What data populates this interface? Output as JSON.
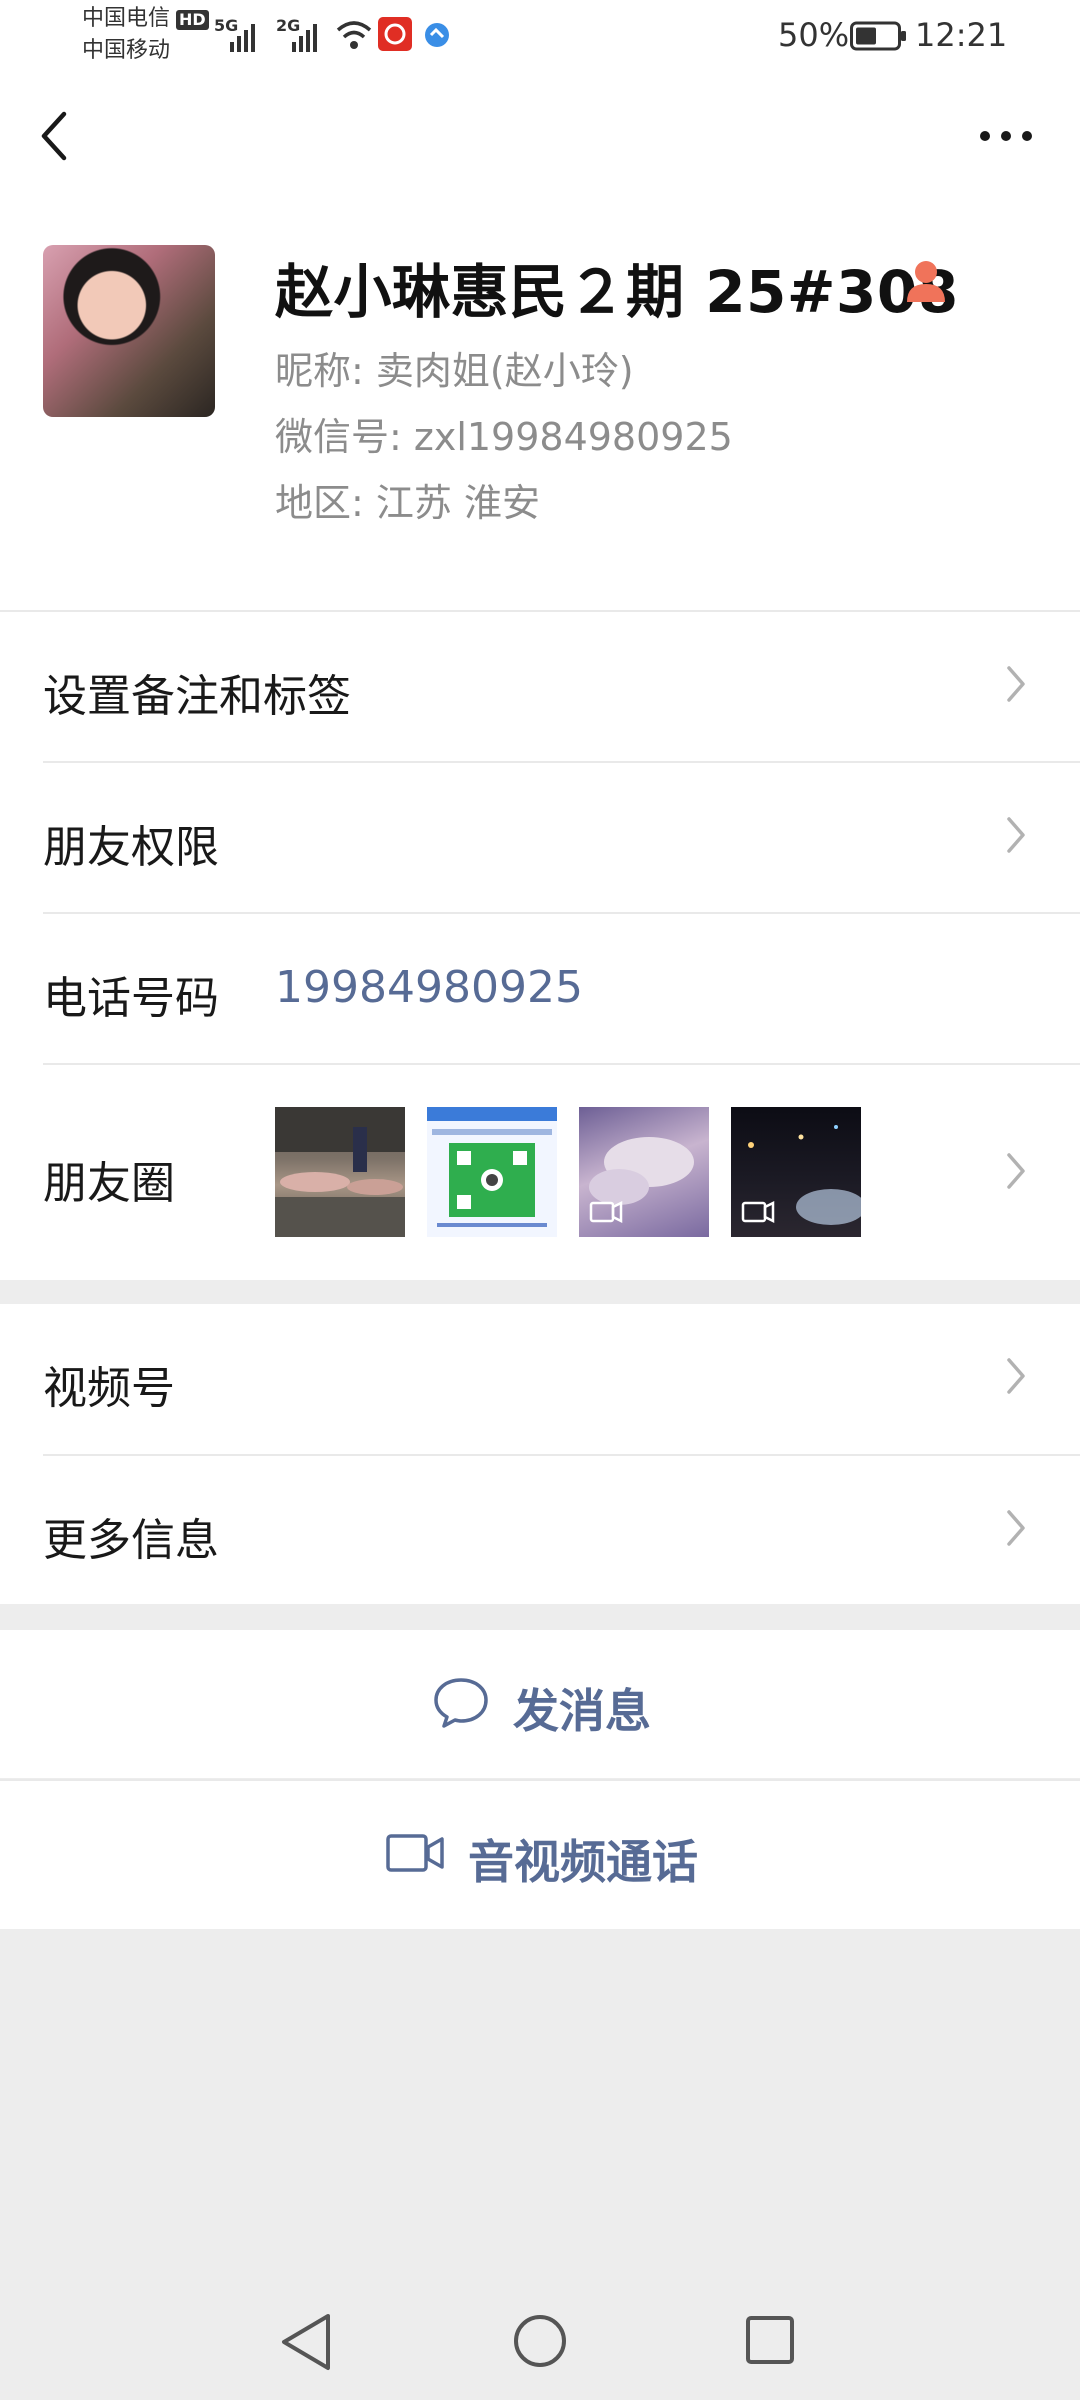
{
  "status_bar": {
    "carrier_1": "中国电信",
    "hd_badge": "HD",
    "carrier_2": "中国移动",
    "net_5g": "5G",
    "net_2g": "2G",
    "battery_percent": "50%",
    "time": "12:21"
  },
  "profile": {
    "name": "赵小琳惠民２期 25#308",
    "nickname_line": "昵称:  卖肉姐(赵小玲)",
    "wechat_id_line": "微信号:  zxl19984980925",
    "region_line": "地区:  江苏  淮安"
  },
  "rows": {
    "remark_tags": "设置备注和标签",
    "friend_permissions": "朋友权限",
    "phone_label": "电话号码",
    "phone_value": "19984980925",
    "moments": "朋友圈",
    "channels": "视频号",
    "more_info": "更多信息"
  },
  "actions": {
    "send_message": "发消息",
    "av_call": "音视频通话"
  },
  "colors": {
    "link_blue": "#576b95",
    "accent_orange": "#f0735a",
    "bg_gray": "#ededed"
  }
}
